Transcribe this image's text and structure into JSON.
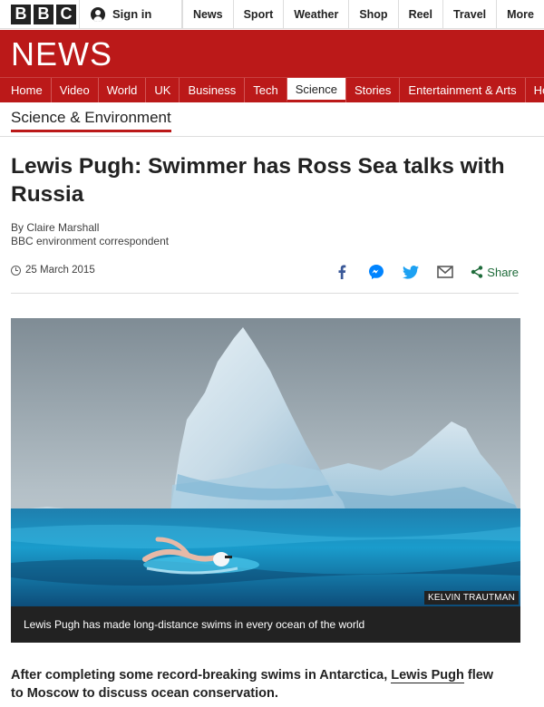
{
  "top_bar": {
    "logo_letters": [
      "B",
      "B",
      "C"
    ],
    "sign_in": "Sign in",
    "links": [
      "News",
      "Sport",
      "Weather",
      "Shop",
      "Reel",
      "Travel",
      "More"
    ]
  },
  "brand": {
    "news_word": "NEWS",
    "color": "#bb1919"
  },
  "nav": {
    "items": [
      "Home",
      "Video",
      "World",
      "UK",
      "Business",
      "Tech",
      "Science",
      "Stories",
      "Entertainment & Arts",
      "He"
    ],
    "active": "Science"
  },
  "section": "Science & Environment",
  "article": {
    "headline": "Lewis Pugh: Swimmer has Ross Sea talks with Russia",
    "author": "By Claire Marshall",
    "author_role": "BBC environment correspondent",
    "date": "25 March 2015",
    "share_label": "Share",
    "share_icons": [
      "facebook-icon",
      "messenger-icon",
      "twitter-icon",
      "email-icon",
      "share-icon"
    ],
    "image": {
      "credit": "KELVIN TRAUTMAN",
      "caption": "Lewis Pugh has made long-distance swims in every ocean of the world"
    },
    "lead_before": "After completing some record-breaking swims in Antarctica, ",
    "lead_link": "Lewis Pugh",
    "lead_after": " flew to Moscow to discuss ocean conservation."
  }
}
